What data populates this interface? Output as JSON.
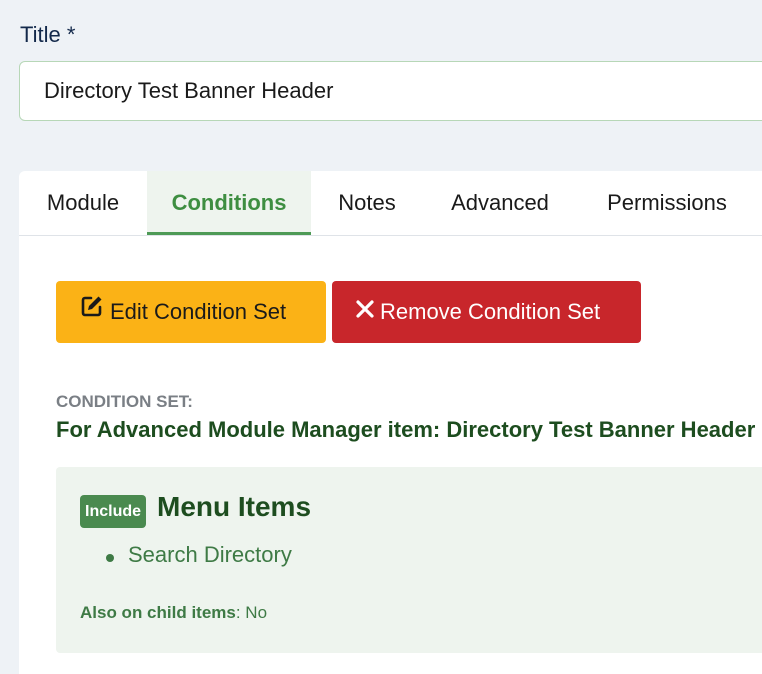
{
  "form": {
    "title_label": "Title *",
    "title_value": "Directory Test Banner Header"
  },
  "tabs": [
    {
      "label": "Module",
      "active": false
    },
    {
      "label": "Conditions",
      "active": true
    },
    {
      "label": "Notes",
      "active": false
    },
    {
      "label": "Advanced",
      "active": false
    },
    {
      "label": "Permissions",
      "active": false
    }
  ],
  "actions": {
    "edit_label": "Edit Condition Set",
    "edit_icon": "edit-icon",
    "remove_label": "Remove Condition Set",
    "remove_icon": "close-icon"
  },
  "condition_set": {
    "label": "CONDITION SET:",
    "value": "For Advanced Module Manager item: Directory Test Banner Header",
    "group": {
      "badge": "Include",
      "title": "Menu Items",
      "items": [
        "Search Directory"
      ],
      "child_label": "Also on child items",
      "child_value": ": No"
    }
  },
  "colors": {
    "accent_green": "#4e9a56",
    "edit_button": "#fbb216",
    "remove_button": "#c8262b",
    "condition_text": "#1d4d1f"
  }
}
